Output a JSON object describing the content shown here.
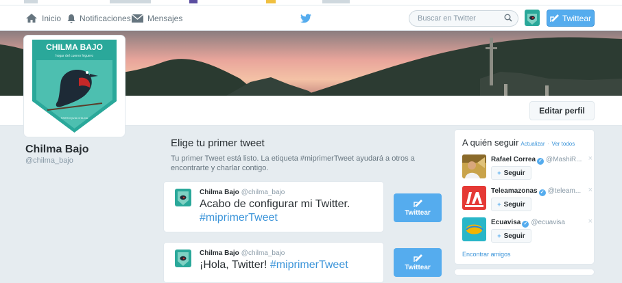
{
  "nav": {
    "home_label": "Inicio",
    "notifications_label": "Notificaciones",
    "messages_label": "Mensajes",
    "search_placeholder": "Buscar en Twitter",
    "tweet_button": "Twittear",
    "icons": {
      "home": "home-icon",
      "notifications": "bell-icon",
      "messages": "envelope-icon",
      "logo": "twitter-bird-icon",
      "search": "search-icon",
      "compose": "compose-icon"
    }
  },
  "colors": {
    "accent": "#55acee",
    "link": "#3b94d9",
    "page_bg": "#e6ecf0",
    "avatar_teal": "#2aa89a"
  },
  "profile": {
    "name": "Chilma Bajo",
    "handle": "@chilma_bajo",
    "edit_button": "Editar perfil",
    "avatar_logo": {
      "title": "CHILMA BAJO",
      "subtitle": "hogar del cuervo higuero",
      "footer": "PARROQUIA CHILMA"
    }
  },
  "first_tweet": {
    "title": "Elige tu primer tweet",
    "description": "Tu primer Tweet está listo. La etiqueta #miprimerTweet ayudará a otros a encontrarte y charlar contigo.",
    "tweets": [
      {
        "name": "Chilma Bajo",
        "handle": "@chilma_bajo",
        "text": "Acabo de configurar mi Twitter.",
        "hashtag": "#miprimerTweet",
        "button": "Twittear"
      },
      {
        "name": "Chilma Bajo",
        "handle": "@chilma_bajo",
        "text": "¡Hola, Twitter!",
        "hashtag": "#miprimerTweet",
        "button": "Twittear"
      }
    ]
  },
  "who_to_follow": {
    "title": "A quién seguir",
    "refresh": "Actualizar",
    "separator": "·",
    "view_all": "Ver todos",
    "follow_label": "Seguir",
    "close": "×",
    "suggestions": [
      {
        "name": "Rafael Correa",
        "handle": "@MashiR...",
        "verified": true
      },
      {
        "name": "Teleamazonas",
        "handle": "@teleam...",
        "verified": true
      },
      {
        "name": "Ecuavisa",
        "handle": "@ecuavisa",
        "verified": true
      }
    ],
    "find_friends": "Encontrar amigos"
  }
}
